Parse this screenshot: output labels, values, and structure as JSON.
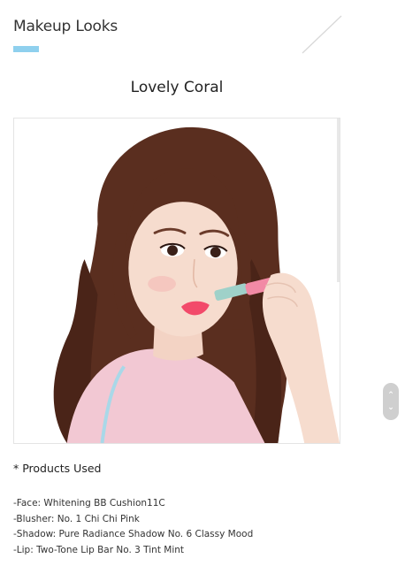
{
  "page": {
    "heading": "Makeup Looks"
  },
  "look": {
    "title": "Lovely Coral",
    "image_alt": "model-applying-lipstick"
  },
  "products": {
    "heading": "* Products Used",
    "items": [
      "-Face: Whitening BB Cushion11C",
      "-Blusher: No. 1 Chi Chi Pink",
      "-Shadow: Pure Radiance Shadow No. 6 Classy Mood",
      "-Lip: Two-Tone Lip Bar No. 3 Tint Mint"
    ]
  },
  "scroll_control": {
    "up_glyph": "⌃",
    "down_glyph": "⌄"
  },
  "colors": {
    "accent": "#8fd0ee",
    "hair": "#5a2e1f",
    "skin": "#f6dcce",
    "top": "#f2c8d3",
    "lipstick": "#f28aa5"
  }
}
